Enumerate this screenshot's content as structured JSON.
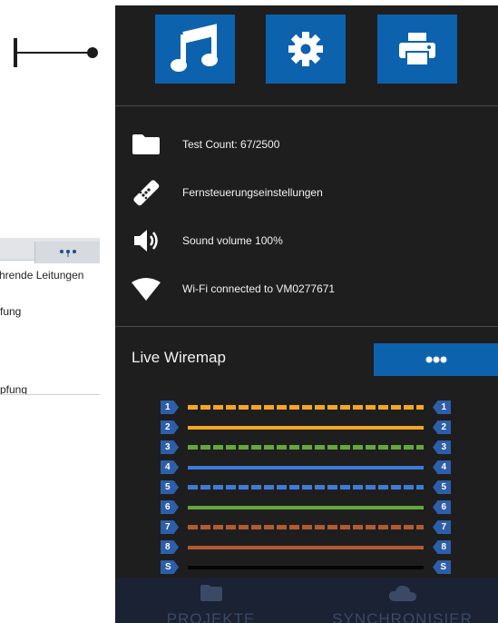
{
  "background_window": {
    "lines": [
      "hrende Leitungen",
      "fung",
      "pfung"
    ]
  },
  "device": {
    "toolbar": [
      {
        "icon": "music-note-icon"
      },
      {
        "icon": "gear-icon"
      },
      {
        "icon": "printer-icon"
      }
    ],
    "status": {
      "test_count": "Test Count: 67/2500",
      "remote_settings": "Fernsteuerungseinstellungen",
      "sound": "Sound volume 100%",
      "wifi": "Wi-Fi connected to VM0277671"
    },
    "live_wiremap": {
      "title": "Live Wiremap",
      "more_icon": "ellipsis-icon",
      "wires": [
        {
          "pin": "1",
          "color": "#f5a623",
          "pattern": "striped"
        },
        {
          "pin": "2",
          "color": "#f5a623",
          "pattern": "solid"
        },
        {
          "pin": "3",
          "color": "#63a83a",
          "pattern": "striped"
        },
        {
          "pin": "4",
          "color": "#3e7bd9",
          "pattern": "solid"
        },
        {
          "pin": "5",
          "color": "#3e7bd9",
          "pattern": "striped"
        },
        {
          "pin": "6",
          "color": "#63a83a",
          "pattern": "solid"
        },
        {
          "pin": "7",
          "color": "#b25a32",
          "pattern": "striped"
        },
        {
          "pin": "8",
          "color": "#b25a32",
          "pattern": "solid"
        },
        {
          "pin": "S",
          "color": "#050505",
          "pattern": "solid"
        }
      ]
    },
    "bottom_nav": [
      {
        "label": "PROJEKTE",
        "icon": "folder-icon"
      },
      {
        "label": "SYNCHRONISIER",
        "icon": "cloud-icon"
      }
    ]
  }
}
